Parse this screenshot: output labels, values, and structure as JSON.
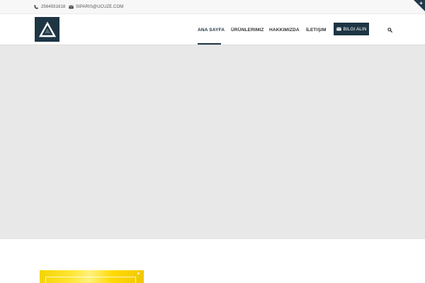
{
  "topbar": {
    "phone": "2564931618",
    "email": "SIPARIS@UCUZE.COM",
    "phone_icon": "phone-icon",
    "mail_icon": "envelope-icon",
    "corner_icon": "plus-icon"
  },
  "header": {
    "logo_icon": "triangle-logo",
    "nav": [
      {
        "label": "ANA SAYFA",
        "active": true
      },
      {
        "label": "ÜRÜNLERIMIZ",
        "active": false
      },
      {
        "label": "HAKKIMIZDA",
        "active": false
      },
      {
        "label": "İLETIŞIM",
        "active": false
      }
    ],
    "cta_label": "BILGI ALIN",
    "cta_icon": "envelope-icon",
    "search_icon": "search-icon"
  },
  "colors": {
    "brand": "#1e3544",
    "hero_bg": "#e8e8e8",
    "topbar_bg": "#f7f7f7",
    "thumb_accent": "#ffe534"
  }
}
